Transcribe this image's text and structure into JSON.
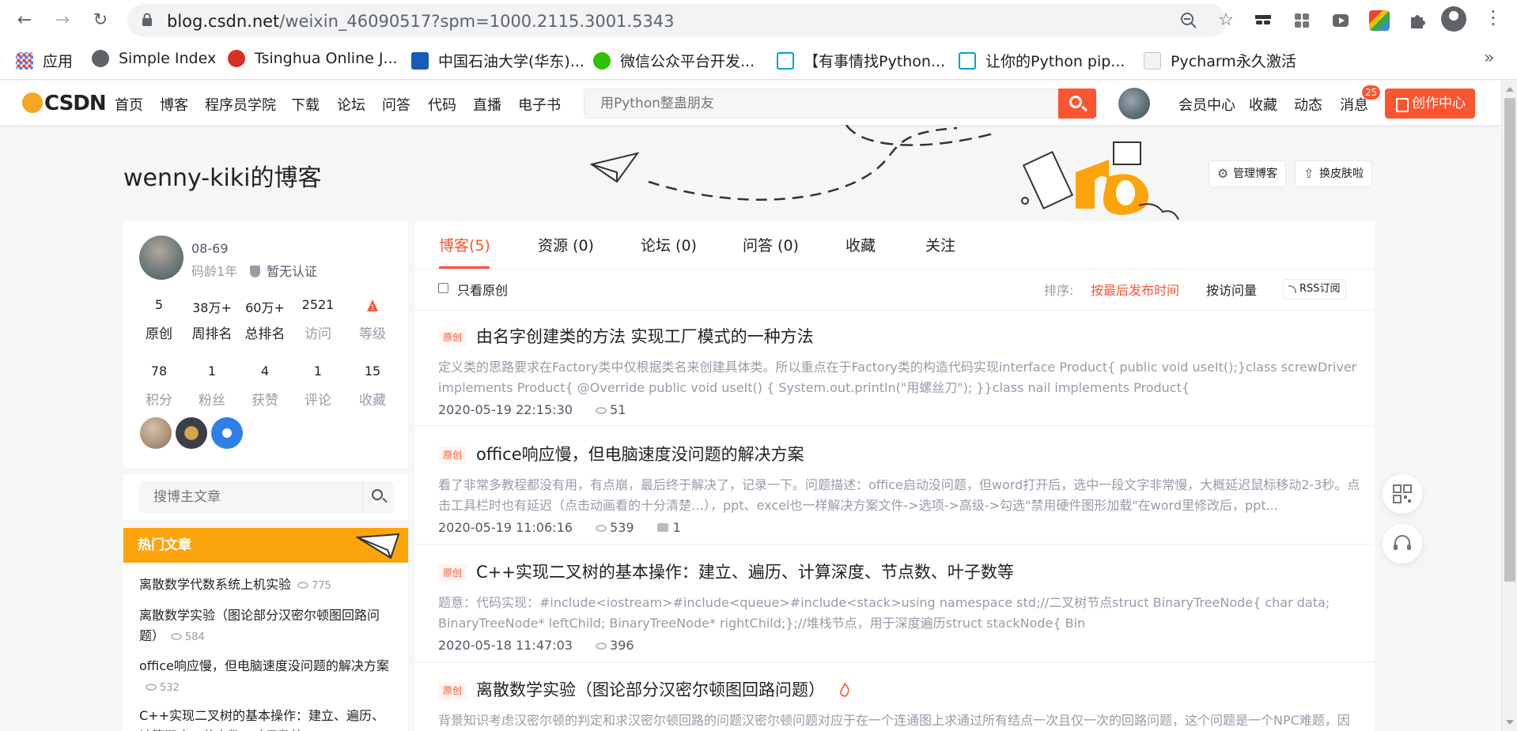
{
  "browser": {
    "url_host": "blog.csdn.net",
    "url_path": "/weixin_46090517?spm=1000.2115.3001.5343",
    "bookmarks": [
      {
        "label": "应用",
        "color": "#ea4335"
      },
      {
        "label": "Simple Index",
        "color": "#5f6368"
      },
      {
        "label": "Tsinghua Online J...",
        "color": "#d93025"
      },
      {
        "label": "中国石油大学(华东)...",
        "color": "#1a5bb5"
      },
      {
        "label": "微信公众平台开发...",
        "color": "#2dc100"
      },
      {
        "label": "【有事情找Python...",
        "color": "#00a1d6"
      },
      {
        "label": "让你的Python pip...",
        "color": "#00a1d6"
      },
      {
        "label": "Pycharm永久激活",
        "color": "#9aa0a6"
      }
    ],
    "more_glyph": "»"
  },
  "csdn": {
    "logo": "CSDN",
    "nav": [
      "首页",
      "博客",
      "程序员学院",
      "下载",
      "论坛",
      "问答",
      "代码",
      "直播",
      "电子书"
    ],
    "search_placeholder": "用Python整蛊朋友",
    "right_nav": [
      "会员中心",
      "收藏",
      "动态",
      "消息"
    ],
    "message_badge": "25",
    "create_label": "创作中心",
    "accent": "#fc5531"
  },
  "blog": {
    "title": "wenny-kiki的博客",
    "manage_label": "管理博客",
    "skin_label": "换皮肤啦"
  },
  "profile": {
    "join": "08-69",
    "age": "码龄1年",
    "cert": "暂无认证",
    "stats_row1": [
      {
        "value": "5",
        "label": "原创"
      },
      {
        "value": "38万+",
        "label": "周排名"
      },
      {
        "value": "60万+",
        "label": "总排名"
      },
      {
        "value": "2521",
        "label": "访问"
      },
      {
        "value": "",
        "label": "等级"
      }
    ],
    "stats_row2": [
      {
        "value": "78",
        "label": "积分"
      },
      {
        "value": "1",
        "label": "粉丝"
      },
      {
        "value": "4",
        "label": "获赞"
      },
      {
        "value": "1",
        "label": "评论"
      },
      {
        "value": "15",
        "label": "收藏"
      }
    ],
    "search_placeholder": "搜博主文章"
  },
  "hot": {
    "title": "热门文章",
    "items": [
      {
        "title": "离散数学代数系统上机实验",
        "views": "775"
      },
      {
        "title": "离散数学实验（图论部分汉密尔顿图回路问题）",
        "views": "584"
      },
      {
        "title": "office响应慢，但电脑速度没问题的解决方案",
        "views": "532"
      },
      {
        "title": "C++实现二叉树的基本操作：建立、遍历、计算深度、节点数、叶子数等",
        "views": ""
      }
    ]
  },
  "tabs": [
    "博客(5)",
    "资源 (0)",
    "论坛 (0)",
    "问答 (0)",
    "收藏",
    "关注"
  ],
  "filter": {
    "original_only": "只看原创",
    "sort_label": "排序:",
    "sort_time": "按最后发布时间",
    "sort_views": "按访问量",
    "rss": "RSS订阅"
  },
  "articles": [
    {
      "tag": "原创",
      "title": "由名字创建类的方法 实现工厂模式的一种方法",
      "desc": "定义类的思路要求在Factory类中仅根据类名来创建具体类。所以重点在于Factory类的构造代码实现interface Product{ public void useIt();}class screwDriver implements Product{ @Override public void useIt() { System.out.println(\"用螺丝刀\"); }}class nail implements Product{",
      "date": "2020-05-19 22:15:30",
      "views": "51",
      "comments": ""
    },
    {
      "tag": "原创",
      "title": "office响应慢，但电脑速度没问题的解决方案",
      "desc": "看了非常多教程都没有用，有点崩，最后终于解决了，记录一下。问题描述：office启动没问题，但word打开后，选中一段文字非常慢，大概延迟鼠标移动2-3秒。点击工具栏时也有延迟（点击动画看的十分清楚…），ppt、excel也一样解决方案文件->选项->高级->勾选\"禁用硬件图形加载\"在word里修改后，ppt...",
      "date": "2020-05-19 11:06:16",
      "views": "539",
      "comments": "1"
    },
    {
      "tag": "原创",
      "title": "C++实现二叉树的基本操作：建立、遍历、计算深度、节点数、叶子数等",
      "desc": "题意：代码实现：#include<iostream>#include<queue>#include<stack>using namespace std;//二叉树节点struct BinaryTreeNode{ char data; BinaryTreeNode* leftChild; BinaryTreeNode* rightChild;};//堆栈节点，用于深度遍历struct stackNode{ Bin",
      "date": "2020-05-18 11:47:03",
      "views": "396",
      "comments": ""
    },
    {
      "tag": "原创",
      "title": "离散数学实验（图论部分汉密尔顿图回路问题）",
      "desc": "背景知识考虑汉密尔顿的判定和求汉密尔顿回路的问题汉密尔顿问题对应于在一个连通图上求通过所有结点一次且仅一次的回路问题，这个问题是一个NPC难题，因此，寻找有效的算法，判断一个连通图是不是汉密尔顿图是基本的方法就是使用递归穷举的方法。递归穷举的方式对于结点数较少的连通...",
      "date": "",
      "views": "",
      "comments": ""
    }
  ]
}
